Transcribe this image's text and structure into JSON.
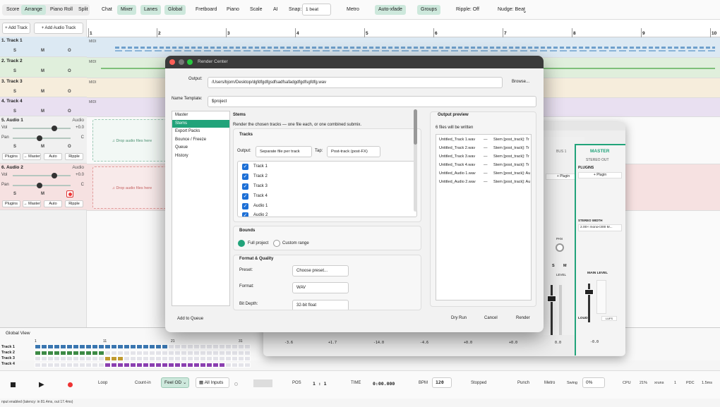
{
  "toolbar": {
    "view_tabs": [
      "Score",
      "Arrange",
      "Piano Roll",
      "Split"
    ],
    "buttons": [
      "Chat",
      "Mixer",
      "Lanes",
      "Global",
      "Fretboard",
      "Piano",
      "Scale",
      "AI"
    ],
    "snap_label": "Snap:",
    "snap_value": "1 beat",
    "metro": "Metro",
    "auto_xfade": "Auto-xfade",
    "groups": "Groups",
    "ripple": "Ripple: Off",
    "nudge": "Nudge: Beat"
  },
  "tracks_panel": {
    "add_track": "+ Add Track",
    "add_audio_track": "+ Add Audio Track",
    "solo": "S",
    "mute": "M",
    "arm": "O",
    "tracks": [
      {
        "name": "1. Track 1"
      },
      {
        "name": "2. Track 2"
      },
      {
        "name": "3. Track 3"
      },
      {
        "name": "4. Track 4"
      }
    ],
    "audio_tracks": [
      {
        "name": "5. Audio 1",
        "type": "Audio",
        "vol_label": "Vol",
        "vol_value": "+0.0",
        "pan_label": "Pan",
        "pan_value": "C",
        "vol_level": 0.72,
        "pan_level": 0.46
      },
      {
        "name": "6. Audio 2",
        "type": "Audio",
        "vol_label": "Vol",
        "vol_value": "+0.0",
        "pan_label": "Pan",
        "pan_value": "C",
        "vol_level": 0.72,
        "pan_level": 0.46
      }
    ],
    "strip_buttons": [
      "Plugins",
      "→ Master",
      "Auto",
      "Ripple"
    ]
  },
  "arrange": {
    "bars": [
      "1",
      "2",
      "3",
      "4",
      "5",
      "6",
      "7",
      "8",
      "9",
      "10"
    ],
    "midi_tag": "MIDI",
    "drop_hint": "♫ Drop audio files here"
  },
  "global_view": {
    "title": "Global View",
    "bar_marks": [
      "1",
      "11",
      "21",
      "31"
    ],
    "rows": [
      "Track 1",
      "Track 2",
      "Track 3",
      "Track 4"
    ]
  },
  "transport": {
    "loop": "Loop",
    "count_in": "Count-in",
    "feel": "Feel OD",
    "inputs": "All Inputs",
    "pos_label": "POS",
    "pos_value": "1 : 1",
    "time_label": "TIME",
    "time_value": "0:00.000",
    "bpm_label": "BPM",
    "bpm_value": "120",
    "state": "Stopped",
    "punch": "Punch",
    "metro": "Metro",
    "swing_label": "Swing",
    "swing_value": "0%",
    "cpu_label": "CPU",
    "cpu_value": "21%",
    "xruns_label": "xruns",
    "xruns_value": "1",
    "pdc_label": "PDC",
    "pdc_value": "1.5ms"
  },
  "status": "nput enabled (latency: in 81.4ms, out 17.4ms)",
  "mixer": {
    "bus_label": "BUS 1",
    "master_label": "MASTER",
    "stereo_out": "STEREO OUT",
    "plugins_label": "PLUGINS",
    "add_plugin": "+ Plugin",
    "stereo_width_label": "STEREO WIDTH",
    "stereo_width_value": "2.00× mono<300 M...",
    "main_level": "MAIN LEVEL",
    "loud_label": "LOUD",
    "lufs": "LUFS",
    "level_label": "LEVEL",
    "pan_label": "PAN",
    "strip_values": [
      "-3.6",
      "+1.7",
      "-14.0",
      "-4.6",
      "+0.0",
      "+0.0",
      "0.0",
      "-0.0"
    ]
  },
  "render": {
    "title": "Render Center",
    "output_label": "Output:",
    "output_path": "/Users/bjorn/Desktop/dgfdfgdfgsdfsadfsafadgdfgdfsgfdfg.wav",
    "browse": "Browse...",
    "name_template_label": "Name Template:",
    "name_template": "$project",
    "nav": [
      "Master",
      "Stems",
      "Export Packs",
      "Bounce / Freeze",
      "Queue",
      "History"
    ],
    "stems_title": "Stems",
    "stems_desc": "Render the chosen tracks — one file each, or one combined submix.",
    "tracks_title": "Tracks",
    "out_label": "Output:",
    "out_value": "Separate file per track",
    "tap_label": "Tap:",
    "tap_value": "Post-track (post-FX)",
    "checklist": [
      "Track 1",
      "Track 2",
      "Track 3",
      "Track 4",
      "Audio 1",
      "Audio 2"
    ],
    "bounds_title": "Bounds",
    "full_project": "Full project",
    "custom_range": "Custom range",
    "format_title": "Format & Quality",
    "preset_label": "Preset:",
    "preset_value": "Choose preset...",
    "format_label": "Format:",
    "format_value": "WAV",
    "bit_depth_label": "Bit Depth:",
    "bit_depth_value": "32-bit float",
    "preview_title": "Output preview",
    "preview_count": "6 files will be written",
    "preview_files": [
      {
        "file": "Untitled_Track 1.wav",
        "desc": "Stem [post_track]: Tr"
      },
      {
        "file": "Untitled_Track 2.wav",
        "desc": "Stem [post_track]: Tr"
      },
      {
        "file": "Untitled_Track 3.wav",
        "desc": "Stem [post_track]: Tr"
      },
      {
        "file": "Untitled_Track 4.wav",
        "desc": "Stem [post_track]: Tr"
      },
      {
        "file": "Untitled_Audio 1.wav",
        "desc": "Stem [post_track]: Au"
      },
      {
        "file": "Untitled_Audio 2.wav",
        "desc": "Stem [post_track]: Au"
      }
    ],
    "dash": "—",
    "add_to_queue": "Add to Queue",
    "dry_run": "Dry Run",
    "cancel": "Cancel",
    "render_btn": "Render"
  },
  "colors": {
    "accent": "#21a37a",
    "accent_soft": "#cde8dc",
    "track1": "#dce9f3",
    "track2": "#e0efdc",
    "track3": "#f6eddc",
    "track4": "#e9e0f1",
    "audio": "#f6e1e1"
  }
}
